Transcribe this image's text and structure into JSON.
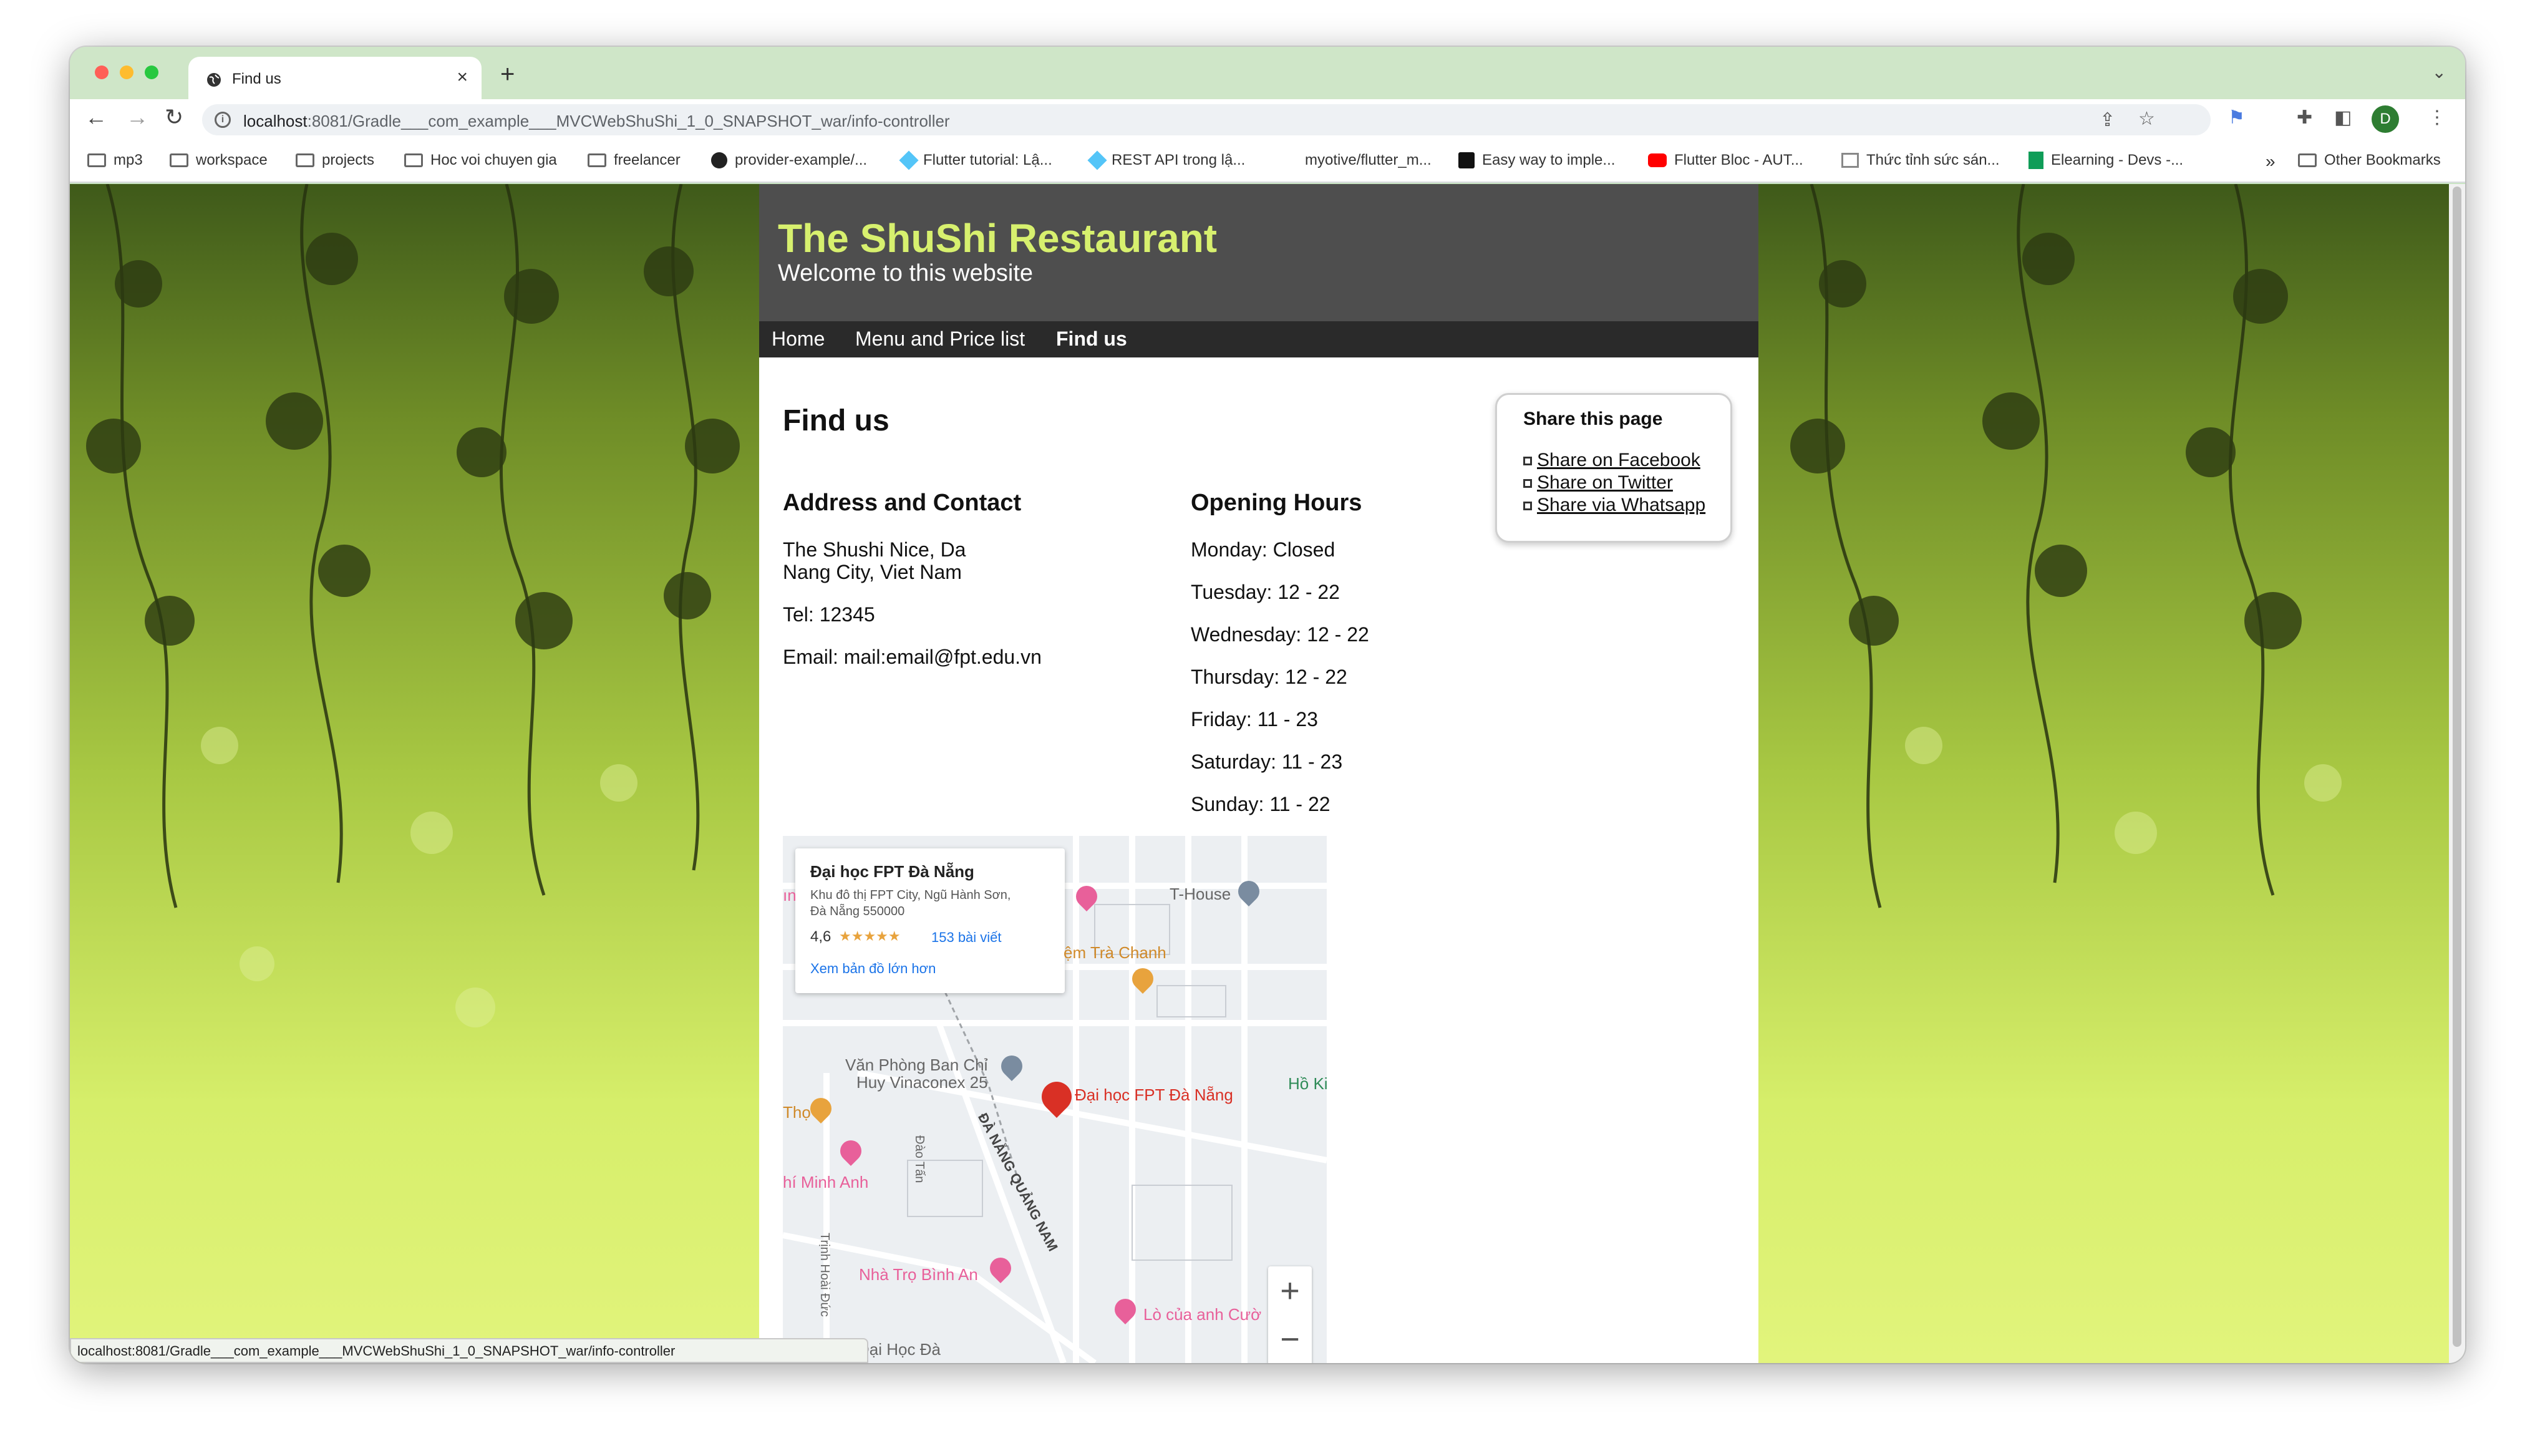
{
  "browser": {
    "tab_title": "Find us",
    "url_host": "localhost",
    "url_rest": ":8081/Gradle___com_example___MVCWebShuShi_1_0_SNAPSHOT_war/info-controller",
    "profile_initial": "D",
    "status_url": "localhost:8081/Gradle___com_example___MVCWebShuShi_1_0_SNAPSHOT_war/info-controller"
  },
  "bookmarks": [
    {
      "label": "mp3",
      "icon": "folder-icon"
    },
    {
      "label": "workspace",
      "icon": "folder-icon"
    },
    {
      "label": "projects",
      "icon": "folder-icon"
    },
    {
      "label": "Hoc voi chuyen gia",
      "icon": "folder-icon"
    },
    {
      "label": "freelancer",
      "icon": "folder-icon"
    },
    {
      "label": "provider-example/...",
      "icon": "github-icon"
    },
    {
      "label": "Flutter tutorial: Lậ...",
      "icon": "flutter-icon"
    },
    {
      "label": "REST API trong lậ...",
      "icon": "flutter-icon"
    },
    {
      "label": "myotive/flutter_m...",
      "icon": "none"
    },
    {
      "label": "Easy way to imple...",
      "icon": "medium-icon"
    },
    {
      "label": "Flutter Bloc - AUT...",
      "icon": "youtube-icon"
    },
    {
      "label": "Thức tỉnh sức sán...",
      "icon": "image-icon"
    },
    {
      "label": "Elearning - Devs -...",
      "icon": "sheet-icon"
    }
  ],
  "bookmarks_overflow": "»",
  "bookmarks_other": "Other Bookmarks",
  "site": {
    "title": "The ShuShi Restaurant",
    "subtitle": "Welcome to this website",
    "nav": [
      "Home",
      "Menu and Price list",
      "Find us"
    ]
  },
  "content": {
    "page_title": "Find us",
    "address_heading": "Address and Contact",
    "address_line1": "The Shushi Nice, Da",
    "address_line2": "Nang City, Viet Nam",
    "tel": "Tel: 12345",
    "email": "Email: mail:email@fpt.edu.vn",
    "hours_heading": "Opening Hours",
    "hours": [
      "Monday: Closed",
      "Tuesday: 12 - 22",
      "Wednesday: 12 - 22",
      "Thursday: 12 - 22",
      "Friday: 11 - 23",
      "Saturday: 11 - 23",
      "Sunday: 11 - 22"
    ]
  },
  "share": {
    "title": "Share this page",
    "links": [
      "Share on Facebook",
      "Share on Twitter",
      "Share via Whatsapp"
    ]
  },
  "map": {
    "card_title": "Đại học FPT Đà Nẵng",
    "card_address_1": "Khu đô thị FPT City, Ngũ Hành Sơn,",
    "card_address_2": "Đà Nẵng 550000",
    "card_rating": "4,6",
    "card_stars": "★★★★★",
    "card_reviews": "153 bài viết",
    "card_link": "Xem bản đồ lớn hơn",
    "labels": {
      "t_house": "T-House",
      "tra_chanh": "ệm Trà Chanh",
      "van_phong_1": "Văn Phòng Ban Chỉ",
      "van_phong_2": "Huy Vinaconex 25",
      "fpt": "Đại học FPT Đà Nẵng",
      "tho": "Thọ",
      "minh_anh": "hí Minh Anh",
      "dao_tan": "Đào Tấn",
      "da_nang_qn": "ĐÀ NẴNG QUẢNG NAM",
      "trinh_hoai_duc": "Trịnh Hoài Đức",
      "nha_tro": "Nhà Trọ Bình An",
      "lo_cua": "Lò của anh Cườ",
      "dai_hoc_da": "Đại Học Đà",
      "ho_ki": "Hồ Ki",
      "in": "ın"
    },
    "zoom_in": "+",
    "zoom_out": "−"
  }
}
